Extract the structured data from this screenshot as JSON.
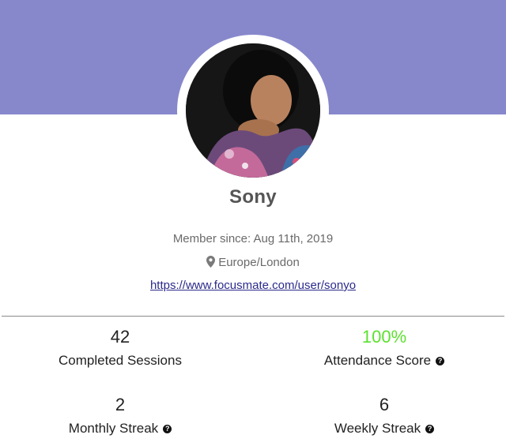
{
  "profile": {
    "name": "Sony",
    "member_since": "Member since: Aug 11th, 2019",
    "location": "Europe/London",
    "url": "https://www.focusmate.com/user/sonyo"
  },
  "stats": {
    "completed_sessions": {
      "value": "42",
      "label": "Completed Sessions"
    },
    "attendance_score": {
      "value": "100%",
      "label": "Attendance Score"
    },
    "monthly_streak": {
      "value": "2",
      "label": "Monthly Streak"
    },
    "weekly_streak": {
      "value": "6",
      "label": "Weekly Streak"
    }
  },
  "icons": {
    "location": "map-pin-icon",
    "help": "question-circle-icon"
  },
  "colors": {
    "header": "#8788cb",
    "attendance_value": "#5ce12f",
    "link": "#2b2a8c"
  }
}
